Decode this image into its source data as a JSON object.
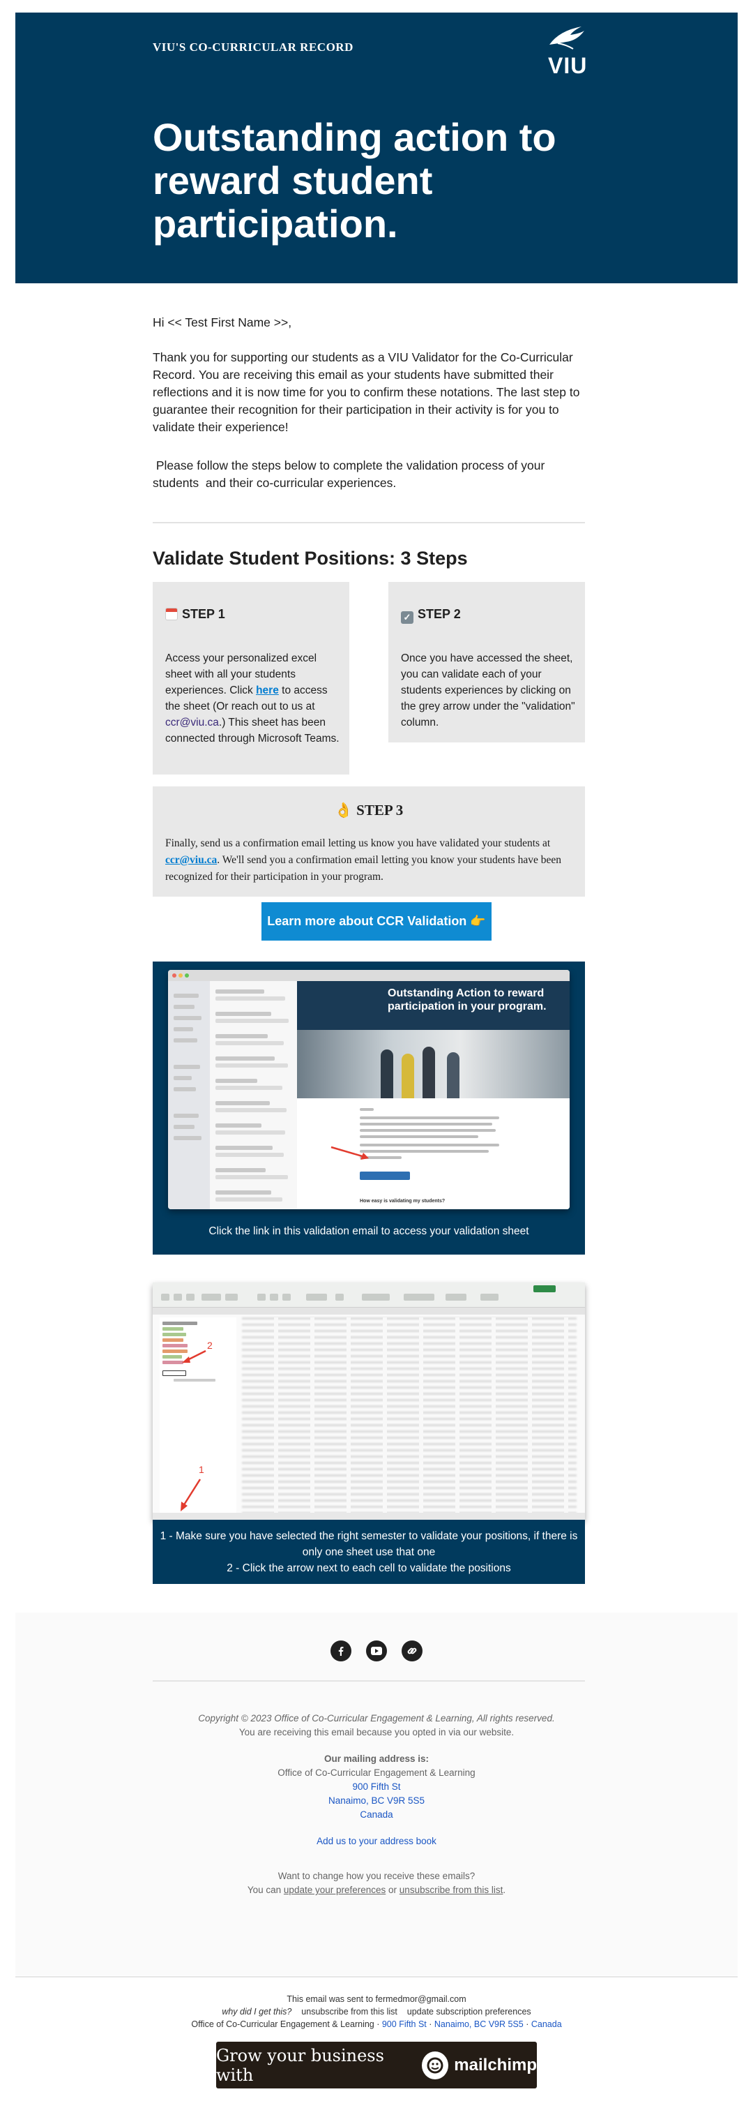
{
  "header": {
    "brand": "VIU'S CO-CURRICULAR RECORD",
    "logo_text": "VIU",
    "title": "Outstanding action to reward student participation."
  },
  "body": {
    "greeting": "Hi << Test First Name >>,",
    "intro": "Thank you for supporting our students as a VIU Validator for the Co-Curricular Record. You are receiving this email as your students have submitted their reflections and it is now time for you to confirm these notations. The last step to guarantee their recognition for their participation in their activity is for you to validate their experience!",
    "steps_intro": " Please follow the steps below to complete the validation process of your students  and their co-curricular experiences.",
    "validate_heading": "Validate Student Positions: 3 Steps"
  },
  "steps": {
    "step1": {
      "title": "STEP 1",
      "icon": "calendar-icon",
      "text_before": "Access your personalized excel sheet with all your students experiences. Click ",
      "link": "here",
      "text_middle": " to access the sheet (Or reach out to us at ",
      "email": "ccr@viu.ca",
      "text_after": ".) This sheet has been connected through Microsoft Teams."
    },
    "step2": {
      "title": "STEP 2",
      "icon": "checkbox-icon",
      "text": "Once you have accessed the sheet, you can validate each of your students experiences by clicking on the grey arrow under the \"validation\" column."
    },
    "step3": {
      "title": "STEP 3",
      "icon": "ok-hand-icon",
      "text_before": "Finally, send us a confirmation email letting us know you have validated your students at ",
      "email": "ccr@viu.ca",
      "text_after": ". We'll send you a confirmation email letting you know your students have been recognized for their participation in your program."
    }
  },
  "cta": {
    "label": "Learn more about CCR Validation 👉"
  },
  "panel1": {
    "mock_title": "Outstanding Action to reward participation in your program.",
    "mock_question": "How easy is validating my students?",
    "caption": "Click the link in this validation email to access your validation sheet"
  },
  "panel2": {
    "marker1": "1",
    "marker2": "2",
    "caption_line1": "1 - Make sure you have selected the right semester to validate your positions, if there is only one sheet use that one",
    "caption_line2": "2 - Click the arrow next to each cell to validate the positions"
  },
  "footer": {
    "social": [
      "facebook-icon",
      "youtube-icon",
      "link-icon"
    ],
    "copyright": "Copyright © 2023 Office of Co-Curricular Engagement & Learning, All rights reserved.",
    "opted": "You are receiving this email because you opted in via our website.",
    "mailing_label": "Our mailing address is:",
    "org": "Office of Co-Curricular Engagement & Learning",
    "street": "900 Fifth St",
    "city": "Nanaimo, BC V9R 5S5",
    "country": "Canada",
    "address_book": "Add us to your address book",
    "change_q": "Want to change how you receive these emails?",
    "change_prefix": "You can ",
    "update_prefs": "update your preferences",
    "or": " or ",
    "unsubscribe": "unsubscribe from this list",
    "period": "."
  },
  "bottom": {
    "sent_prefix": "This email was sent to ",
    "sent_email": "fermedmor@gmail.com",
    "why": "why did I get this?",
    "unsubscribe": "unsubscribe from this list",
    "update": "update subscription preferences",
    "org": "Office of Co-Curricular Engagement & Learning",
    "sep": " · ",
    "street": "900 Fifth St",
    "city": "Nanaimo, BC V9R 5S5",
    "country": "Canada",
    "badge_text": "Grow your business with",
    "badge_brand": "mailchimp"
  },
  "colors": {
    "navy": "#013a5d",
    "card_gray": "#e8e8e8",
    "button_blue": "#0f8bd2",
    "link_blue": "#007cd0"
  }
}
